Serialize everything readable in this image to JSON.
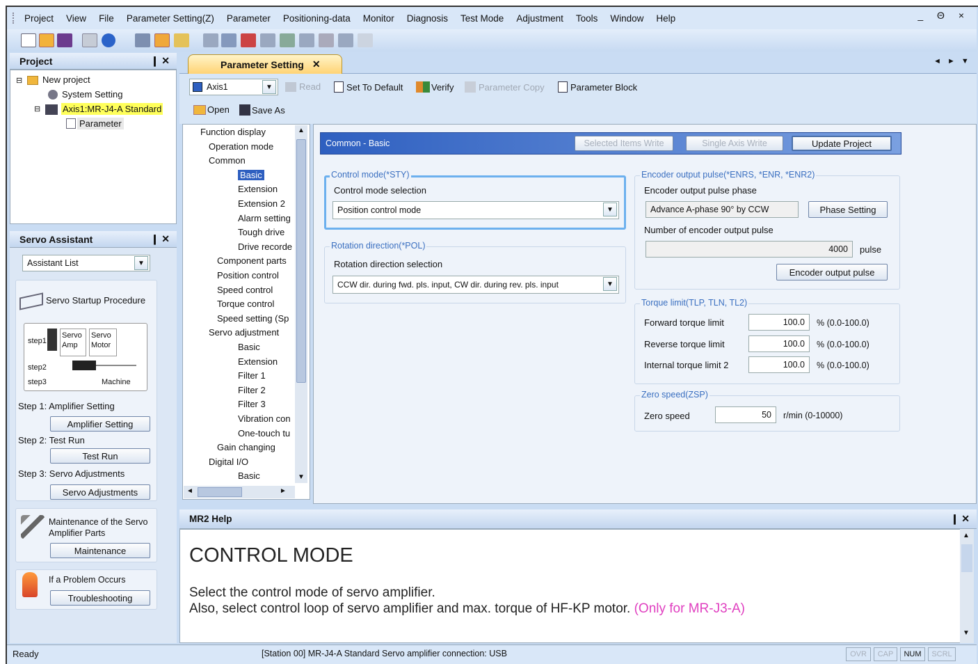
{
  "menu": {
    "items": [
      "Project",
      "View",
      "File",
      "Parameter Setting(Z)",
      "Parameter",
      "Positioning-data",
      "Monitor",
      "Diagnosis",
      "Test Mode",
      "Adjustment",
      "Tools",
      "Window",
      "Help"
    ],
    "window_controls": "_ Θ ×"
  },
  "project_panel": {
    "title": "Project",
    "tree": [
      "New project",
      "System Setting",
      "Axis1:MR-J4-A Standard",
      "Parameter"
    ]
  },
  "servo_assistant": {
    "title": "Servo Assistant",
    "select": "Assistant List",
    "startup_title": "Servo Startup Procedure",
    "diagram": {
      "step1": "step1",
      "step2": "step2",
      "step3": "step3",
      "amp": "Servo Amp",
      "motor": "Servo Motor",
      "machine": "Machine"
    },
    "step1_label": "Step 1: Amplifier Setting",
    "step1_button": "Amplifier Setting",
    "step2_label": "Step 2: Test Run",
    "step2_button": "Test Run",
    "step3_label": "Step 3: Servo Adjustments",
    "step3_button": "Servo Adjustments",
    "maint_text": "Maintenance of the Servo Amplifier Parts",
    "maint_button": "Maintenance",
    "problem_text": "If a Problem Occurs",
    "problem_button": "Troubleshooting"
  },
  "tab": {
    "title": "Parameter Setting",
    "nav": "◄ ► ▼"
  },
  "param_toolbar": {
    "axis": "Axis1",
    "read": "Read",
    "set_default": "Set To Default",
    "verify": "Verify",
    "param_copy": "Parameter Copy",
    "param_block": "Parameter Block",
    "open": "Open",
    "save_as": "Save As"
  },
  "function_tree": [
    "Function display",
    "Operation mode",
    "Common",
    "Basic",
    "Extension",
    "Extension 2",
    "Alarm setting",
    "Tough drive",
    "Drive recorde",
    "Component parts",
    "Position control",
    "Speed control",
    "Torque control",
    "Speed setting (Sp",
    "Servo adjustment",
    "Basic",
    "Extension",
    "Filter 1",
    "Filter 2",
    "Filter 3",
    "Vibration con",
    "One-touch tu",
    "Gain changing",
    "Digital I/O",
    "Basic"
  ],
  "content": {
    "header": "Common - Basic",
    "selected_write": "Selected Items Write",
    "single_write": "Single Axis Write",
    "update_project": "Update Project",
    "control_mode": {
      "group": "Control mode(*STY)",
      "label": "Control mode selection",
      "value": "Position control mode"
    },
    "rotation": {
      "group": "Rotation direction(*POL)",
      "label": "Rotation direction selection",
      "value": "CCW dir. during fwd. pls. input, CW dir. during rev. pls. input"
    },
    "encoder": {
      "group": "Encoder output pulse(*ENRS, *ENR, *ENR2)",
      "phase_label": "Encoder output pulse phase",
      "phase_value": "Advance A-phase 90° by CCW",
      "phase_button": "Phase Setting",
      "count_label": "Number of encoder output pulse",
      "count_value": "4000",
      "count_unit": "pulse",
      "pulse_button": "Encoder output pulse"
    },
    "torque": {
      "group": "Torque limit(TLP, TLN, TL2)",
      "rows": [
        {
          "label": "Forward torque limit",
          "value": "100.0",
          "unit": "% (0.0-100.0)"
        },
        {
          "label": "Reverse torque limit",
          "value": "100.0",
          "unit": "% (0.0-100.0)"
        },
        {
          "label": "Internal torque limit 2",
          "value": "100.0",
          "unit": "% (0.0-100.0)"
        }
      ]
    },
    "zero": {
      "group": "Zero speed(ZSP)",
      "label": "Zero speed",
      "value": "50",
      "unit": "r/min (0-10000)"
    }
  },
  "help": {
    "title": "MR2 Help",
    "heading": "CONTROL MODE",
    "line1": "Select the control mode of servo amplifier.",
    "line2": "Also, select control loop of servo amplifier and max. torque of HF-KP motor.",
    "note": "(Only for MR-J3-A)"
  },
  "status": {
    "ready": "Ready",
    "connection": "[Station 00] MR-J4-A Standard Servo amplifier connection: USB",
    "indicators": [
      "OVR",
      "CAP",
      "NUM",
      "SCRL"
    ]
  },
  "colors": {
    "accent": "#2e5fc0",
    "help_note": "#e040c0"
  }
}
